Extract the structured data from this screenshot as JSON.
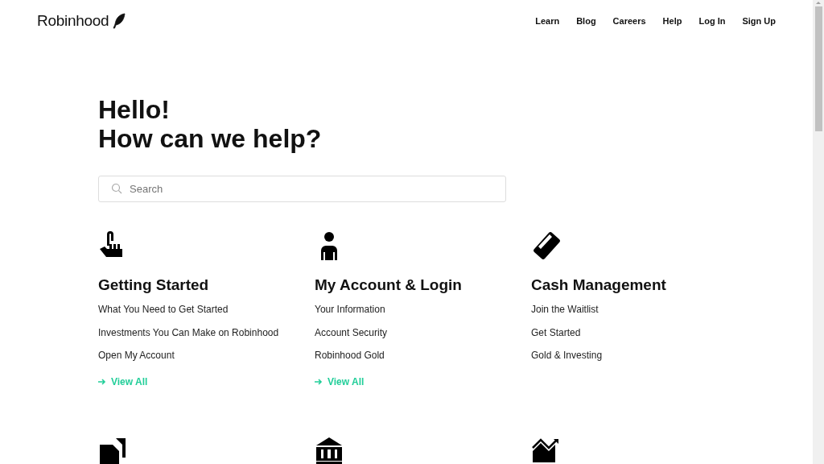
{
  "header": {
    "logo": "Robinhood",
    "nav": [
      "Learn",
      "Blog",
      "Careers",
      "Help",
      "Log In",
      "Sign Up"
    ]
  },
  "hero": {
    "title_lines": [
      "Hello!",
      "How can we help?"
    ]
  },
  "search": {
    "placeholder": "Search"
  },
  "sections": [
    {
      "kind": "pointer",
      "title": "Getting Started",
      "links": [
        "What You Need to Get Started",
        "Investments You Can Make on Robinhood",
        "Open My Account"
      ],
      "view_all": "View All"
    },
    {
      "kind": "person",
      "title": "My Account & Login",
      "links": [
        "Your Information",
        "Account Security",
        "Robinhood Gold"
      ],
      "view_all": "View All"
    },
    {
      "kind": "card",
      "title": "Cash Management",
      "links": [
        "Join the Waitlist",
        "Get Started",
        "Gold & Investing"
      ]
    },
    {
      "kind": "documents"
    },
    {
      "kind": "bank"
    },
    {
      "kind": "chart"
    }
  ]
}
